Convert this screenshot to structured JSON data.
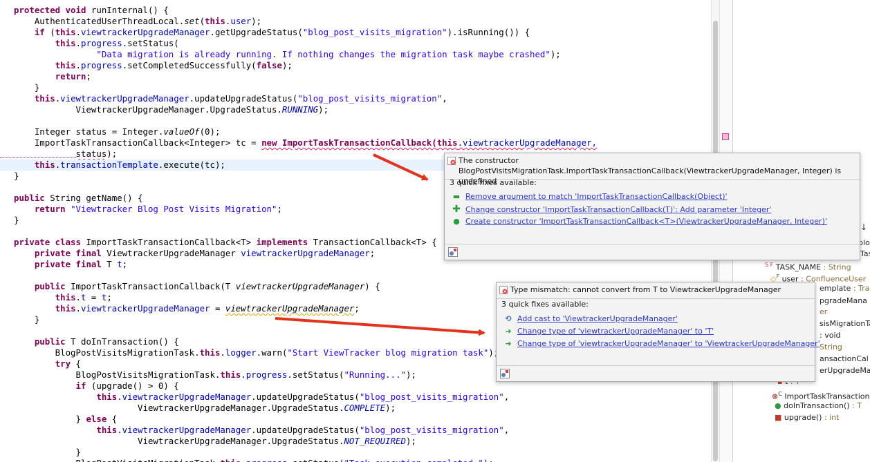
{
  "code": {
    "lines": [
      [
        {
          "t": "protected void ",
          "c": "kw"
        },
        {
          "t": "runInternal() {"
        }
      ],
      [
        {
          "t": "    AuthenticatedUserThreadLocal."
        },
        {
          "t": "set",
          "c": "it"
        },
        {
          "t": "("
        },
        {
          "t": "this",
          "c": "kw"
        },
        {
          "t": "."
        },
        {
          "t": "user",
          "c": "fld"
        },
        {
          "t": ");"
        }
      ],
      [
        {
          "t": "    "
        },
        {
          "t": "if ",
          "c": "kw"
        },
        {
          "t": "("
        },
        {
          "t": "this",
          "c": "kw"
        },
        {
          "t": "."
        },
        {
          "t": "viewtrackerUpgradeManager",
          "c": "fld"
        },
        {
          "t": ".getUpgradeStatus("
        },
        {
          "t": "\"blog_post_visits_migration\"",
          "c": "str"
        },
        {
          "t": ").isRunning()) {"
        }
      ],
      [
        {
          "t": "        "
        },
        {
          "t": "this",
          "c": "kw"
        },
        {
          "t": "."
        },
        {
          "t": "progress",
          "c": "fld"
        },
        {
          "t": ".setStatus("
        }
      ],
      [
        {
          "t": "                "
        },
        {
          "t": "\"Data migration is already running. If nothing changes the migration task maybe crashed\"",
          "c": "str"
        },
        {
          "t": ");"
        }
      ],
      [
        {
          "t": "        "
        },
        {
          "t": "this",
          "c": "kw"
        },
        {
          "t": "."
        },
        {
          "t": "progress",
          "c": "fld"
        },
        {
          "t": ".setCompletedSuccessfully("
        },
        {
          "t": "false",
          "c": "kw"
        },
        {
          "t": ");"
        }
      ],
      [
        {
          "t": "        "
        },
        {
          "t": "return",
          "c": "kw"
        },
        {
          "t": ";"
        }
      ],
      [
        {
          "t": "    }"
        }
      ],
      [
        {
          "t": "    "
        },
        {
          "t": "this",
          "c": "kw"
        },
        {
          "t": "."
        },
        {
          "t": "viewtrackerUpgradeManager",
          "c": "fld"
        },
        {
          "t": ".updateUpgradeStatus("
        },
        {
          "t": "\"blog_post_visits_migration\"",
          "c": "str"
        },
        {
          "t": ","
        }
      ],
      [
        {
          "t": "            ViewtrackerUpgradeManager.UpgradeStatus."
        },
        {
          "t": "RUNNING",
          "c": "itfld"
        },
        {
          "t": ");"
        }
      ],
      [
        {
          "t": ""
        }
      ],
      [
        {
          "t": "    Integer status = Integer."
        },
        {
          "t": "valueOf",
          "c": "it"
        },
        {
          "t": "(0);"
        }
      ],
      [
        {
          "t": "    ImportTaskTransactionCallback<Integer> tc = "
        },
        {
          "t": "new ImportTaskTransactionCallback(",
          "c": "kwsq"
        },
        {
          "t": "this",
          "c": "kwsq2"
        },
        {
          "t": ".viewtrackerUpgradeManager,",
          "c": "fldsq"
        }
      ],
      [
        {
          "t": "            "
        },
        {
          "t": "status",
          "c": "sqplain"
        },
        {
          "t": ");"
        }
      ],
      [
        {
          "t": "    "
        },
        {
          "t": "this",
          "c": "kw"
        },
        {
          "t": "."
        },
        {
          "t": "transactionTemplate",
          "c": "fld"
        },
        {
          "t": ".execute(tc);"
        }
      ],
      [
        {
          "t": "}"
        }
      ],
      [
        {
          "t": ""
        }
      ],
      [
        {
          "t": "public ",
          "c": "kw"
        },
        {
          "t": "String getName() {"
        }
      ],
      [
        {
          "t": "    "
        },
        {
          "t": "return ",
          "c": "kw"
        },
        {
          "t": "\"Viewtracker Blog Post Visits Migration\"",
          "c": "str"
        },
        {
          "t": ";"
        }
      ],
      [
        {
          "t": "}"
        }
      ],
      [
        {
          "t": ""
        }
      ],
      [
        {
          "t": "private class ",
          "c": "kw"
        },
        {
          "t": "ImportTaskTransactionCallback<T> "
        },
        {
          "t": "implements ",
          "c": "kw"
        },
        {
          "t": "TransactionCallback<T> {"
        }
      ],
      [
        {
          "t": "    "
        },
        {
          "t": "private final ",
          "c": "kw"
        },
        {
          "t": "ViewtrackerUpgradeManager "
        },
        {
          "t": "viewtrackerUpgradeManager",
          "c": "fld"
        },
        {
          "t": ";"
        }
      ],
      [
        {
          "t": "    "
        },
        {
          "t": "private final ",
          "c": "kw"
        },
        {
          "t": "T "
        },
        {
          "t": "t",
          "c": "fld"
        },
        {
          "t": ";"
        }
      ],
      [
        {
          "t": ""
        }
      ],
      [
        {
          "t": "    "
        },
        {
          "t": "public ",
          "c": "kw"
        },
        {
          "t": "ImportTaskTransactionCallback(T "
        },
        {
          "t": "viewtrackerUpgradeManager",
          "c": "it"
        },
        {
          "t": ") {"
        }
      ],
      [
        {
          "t": "        "
        },
        {
          "t": "this",
          "c": "kw"
        },
        {
          "t": "."
        },
        {
          "t": "t",
          "c": "fld"
        },
        {
          "t": " = "
        },
        {
          "t": "t",
          "c": "fld"
        },
        {
          "t": ";"
        }
      ],
      [
        {
          "t": "        "
        },
        {
          "t": "this",
          "c": "kw"
        },
        {
          "t": "."
        },
        {
          "t": "viewtrackerUpgradeManager",
          "c": "fld"
        },
        {
          "t": " = "
        },
        {
          "t": "viewtrackerUpgradeManager",
          "c": "itsq"
        },
        {
          "t": ";"
        }
      ],
      [
        {
          "t": "    }"
        }
      ],
      [
        {
          "t": ""
        }
      ],
      [
        {
          "t": "    "
        },
        {
          "t": "public ",
          "c": "kw"
        },
        {
          "t": "T doInTransaction() {"
        }
      ],
      [
        {
          "t": "        BlogPostVisitsMigrationTask."
        },
        {
          "t": "this",
          "c": "kw"
        },
        {
          "t": "."
        },
        {
          "t": "logger",
          "c": "fld"
        },
        {
          "t": ".warn("
        },
        {
          "t": "\"Start ViewTracker blog migration task\"",
          "c": "str"
        },
        {
          "t": ");"
        }
      ],
      [
        {
          "t": "        "
        },
        {
          "t": "try ",
          "c": "kw"
        },
        {
          "t": "{"
        }
      ],
      [
        {
          "t": "            BlogPostVisitsMigrationTask."
        },
        {
          "t": "this",
          "c": "kw"
        },
        {
          "t": "."
        },
        {
          "t": "progress",
          "c": "fld"
        },
        {
          "t": ".setStatus("
        },
        {
          "t": "\"Running...\"",
          "c": "str"
        },
        {
          "t": ");"
        }
      ],
      [
        {
          "t": "            "
        },
        {
          "t": "if ",
          "c": "kw"
        },
        {
          "t": "(upgrade() > 0) {"
        }
      ],
      [
        {
          "t": "                "
        },
        {
          "t": "this",
          "c": "kw"
        },
        {
          "t": "."
        },
        {
          "t": "viewtrackerUpgradeManager",
          "c": "fld"
        },
        {
          "t": ".updateUpgradeStatus("
        },
        {
          "t": "\"blog_post_visits_migration\"",
          "c": "str"
        },
        {
          "t": ","
        }
      ],
      [
        {
          "t": "                        ViewtrackerUpgradeManager.UpgradeStatus."
        },
        {
          "t": "COMPLETE",
          "c": "itfld"
        },
        {
          "t": ");"
        }
      ],
      [
        {
          "t": "            } "
        },
        {
          "t": "else ",
          "c": "kw"
        },
        {
          "t": "{"
        }
      ],
      [
        {
          "t": "                "
        },
        {
          "t": "this",
          "c": "kw"
        },
        {
          "t": "."
        },
        {
          "t": "viewtrackerUpgradeManager",
          "c": "fld"
        },
        {
          "t": ".updateUpgradeStatus("
        },
        {
          "t": "\"blog_post_visits_migration\"",
          "c": "str"
        },
        {
          "t": ","
        }
      ],
      [
        {
          "t": "                        ViewtrackerUpgradeManager.UpgradeStatus."
        },
        {
          "t": "NOT_REQUIRED",
          "c": "itfld"
        },
        {
          "t": ");"
        }
      ],
      [
        {
          "t": "            }"
        }
      ],
      [
        {
          "t": "            BlogPostVisitsMigrationTask."
        },
        {
          "t": "this",
          "c": "kw"
        },
        {
          "t": "."
        },
        {
          "t": "progress",
          "c": "fld"
        },
        {
          "t": ".setStatus("
        },
        {
          "t": "\"Task execution completed.\"",
          "c": "str"
        },
        {
          "t": ");"
        }
      ]
    ]
  },
  "popup1": {
    "title": "The constructor BlogPostVisitsMigrationTask.ImportTaskTransactionCallback(ViewtrackerUpgradeManager, Integer) is undefined",
    "subtitle": "3 quick fixes available:",
    "fixes": [
      {
        "label": "Remove argument to match 'ImportTaskTransactionCallback(Object)'",
        "icon": "remove-icon"
      },
      {
        "label": "Change constructor 'ImportTaskTransactionCallback(T)': Add parameter 'Integer'",
        "icon": "add-icon"
      },
      {
        "label": "Create constructor 'ImportTaskTransactionCallback<T>(ViewtrackerUpgradeManager, Integer)'",
        "icon": "create-constructor-icon"
      }
    ]
  },
  "popup2": {
    "title": "Type mismatch: cannot convert from T to ViewtrackerUpgradeManager",
    "subtitle": "3 quick fixes available:",
    "fixes": [
      {
        "label": "Add cast to 'ViewtrackerUpgradeManager'",
        "icon": "cast-icon"
      },
      {
        "label": "Change type of 'viewtrackerUpgradeManager' to 'T'",
        "icon": "change-type-icon"
      },
      {
        "label": "Change type of 'viewtrackerUpgradeManager' to 'ViewtrackerUpgradeManager'",
        "icon": "change-type-icon"
      }
    ]
  },
  "outline": {
    "toolbar_glyph": "↓",
    "frag_top1": "blog",
    "frag_top2": "Tas",
    "task_name": "TASK_NAME",
    "task_name_type": ": String",
    "user": "user",
    "user_type": ": ConfluenceUser",
    "frag_template": "emplate",
    "frag_template_type": ": Tran",
    "frag_upgrade_mana": "pgradeMana",
    "frag_er": "er",
    "frag_sis_migration": "sisMigrationTa",
    "frag_void": ": void",
    "frag_string": "String",
    "frag_ansaction_cal": "ansactionCal",
    "frag_er_upgrade_ma": "erUpgradeMa",
    "frag_t": "t",
    "frag_t_type": ": T",
    "import_task": "ImportTaskTransaction",
    "do_in_transaction": "doInTransaction()",
    "do_in_transaction_type": ": T",
    "upgrade": "upgrade()",
    "upgrade_type": ": int"
  },
  "colors": {
    "keyword": "#7f0055",
    "field": "#0000c0",
    "string": "#2a00ff",
    "link": "#2e38c8",
    "arrow": "#e2341d",
    "highlight_line": "#e8f2fe"
  }
}
